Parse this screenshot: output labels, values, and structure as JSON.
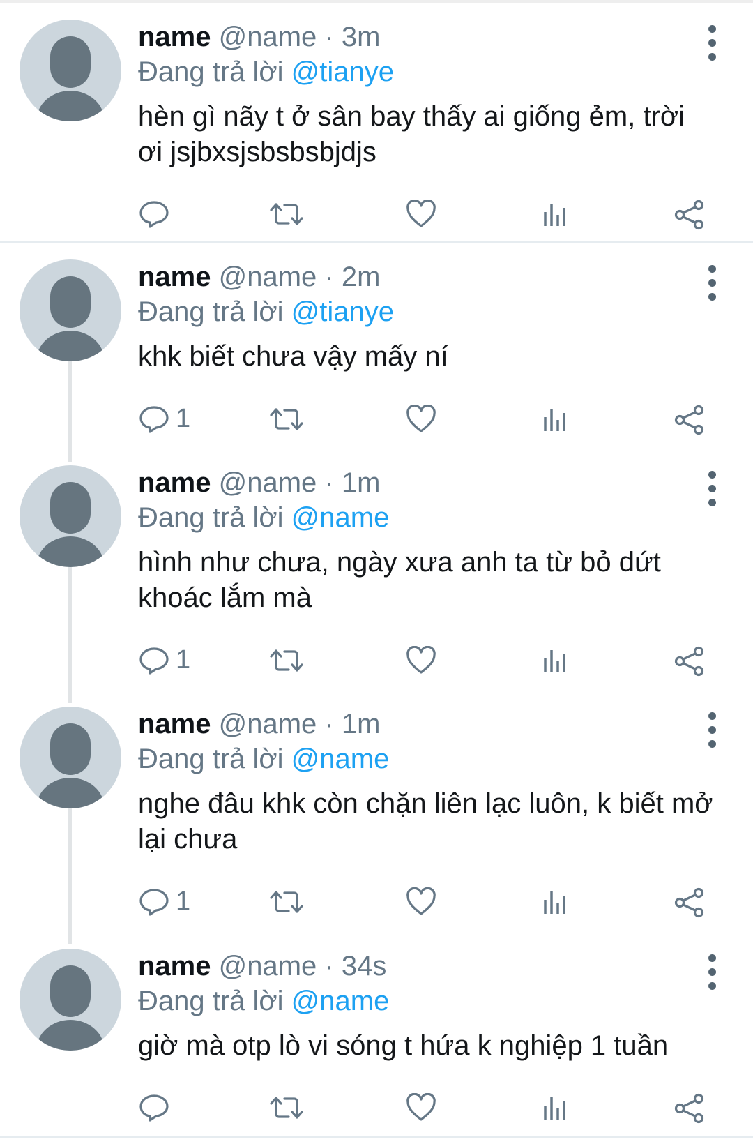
{
  "tweets": [
    {
      "name": "name",
      "handle": "@name",
      "dot": "·",
      "time": "3m",
      "reply_prefix": "Đang trả lời",
      "reply_to": "@tianye",
      "text": "hèn gì nãy t ở sân bay thấy ai giống ẻm, trời ơi jsjbxsjsbsbsbjdjs",
      "reply_count": ""
    },
    {
      "name": "name",
      "handle": "@name",
      "dot": "·",
      "time": "2m",
      "reply_prefix": "Đang trả lời",
      "reply_to": "@tianye",
      "text": "khk biết chưa vậy mấy ní",
      "reply_count": "1"
    },
    {
      "name": "name",
      "handle": "@name",
      "dot": "·",
      "time": "1m",
      "reply_prefix": "Đang trả lời",
      "reply_to": "@name",
      "text": "hình như chưa, ngày xưa anh ta từ bỏ dứt khoác lắm mà",
      "reply_count": "1"
    },
    {
      "name": "name",
      "handle": "@name",
      "dot": "·",
      "time": "1m",
      "reply_prefix": "Đang trả lời",
      "reply_to": "@name",
      "text": "nghe đâu khk còn chặn liên lạc luôn, k biết mở lại chưa",
      "reply_count": "1"
    },
    {
      "name": "name",
      "handle": "@name",
      "dot": "·",
      "time": "34s",
      "reply_prefix": "Đang trả lời",
      "reply_to": "@name",
      "text": "giờ mà otp lò vi sóng t hứa k nghiệp 1 tuần",
      "reply_count": ""
    }
  ],
  "icons": {
    "reply": "reply-icon",
    "retweet": "retweet-icon",
    "like": "heart-icon",
    "analytics": "analytics-icon",
    "share": "share-icon",
    "more": "more-vertical-icon"
  },
  "colors": {
    "accent": "#1da1f2",
    "secondary_text": "#657786",
    "avatar_bg": "#ccd6dd",
    "avatar_fg": "#66757f"
  }
}
